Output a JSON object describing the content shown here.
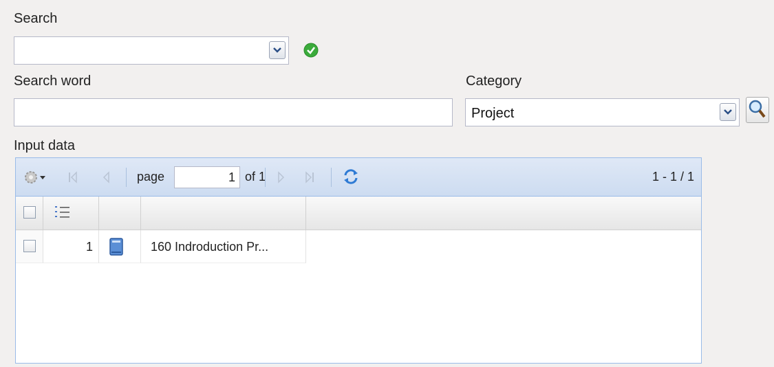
{
  "search": {
    "label": "Search",
    "value": "",
    "ok_icon": "check-circle-icon"
  },
  "search_word": {
    "label": "Search word",
    "value": ""
  },
  "category": {
    "label": "Category",
    "value": "Project",
    "search_icon": "magnifier-icon"
  },
  "input_data": {
    "label": "Input data",
    "toolbar": {
      "page_label": "page",
      "page_value": "1",
      "of_label": "of 1",
      "range": "1 - 1 / 1"
    },
    "rows": [
      {
        "number": "1",
        "title": "160 Indroduction Pr..."
      }
    ]
  }
}
